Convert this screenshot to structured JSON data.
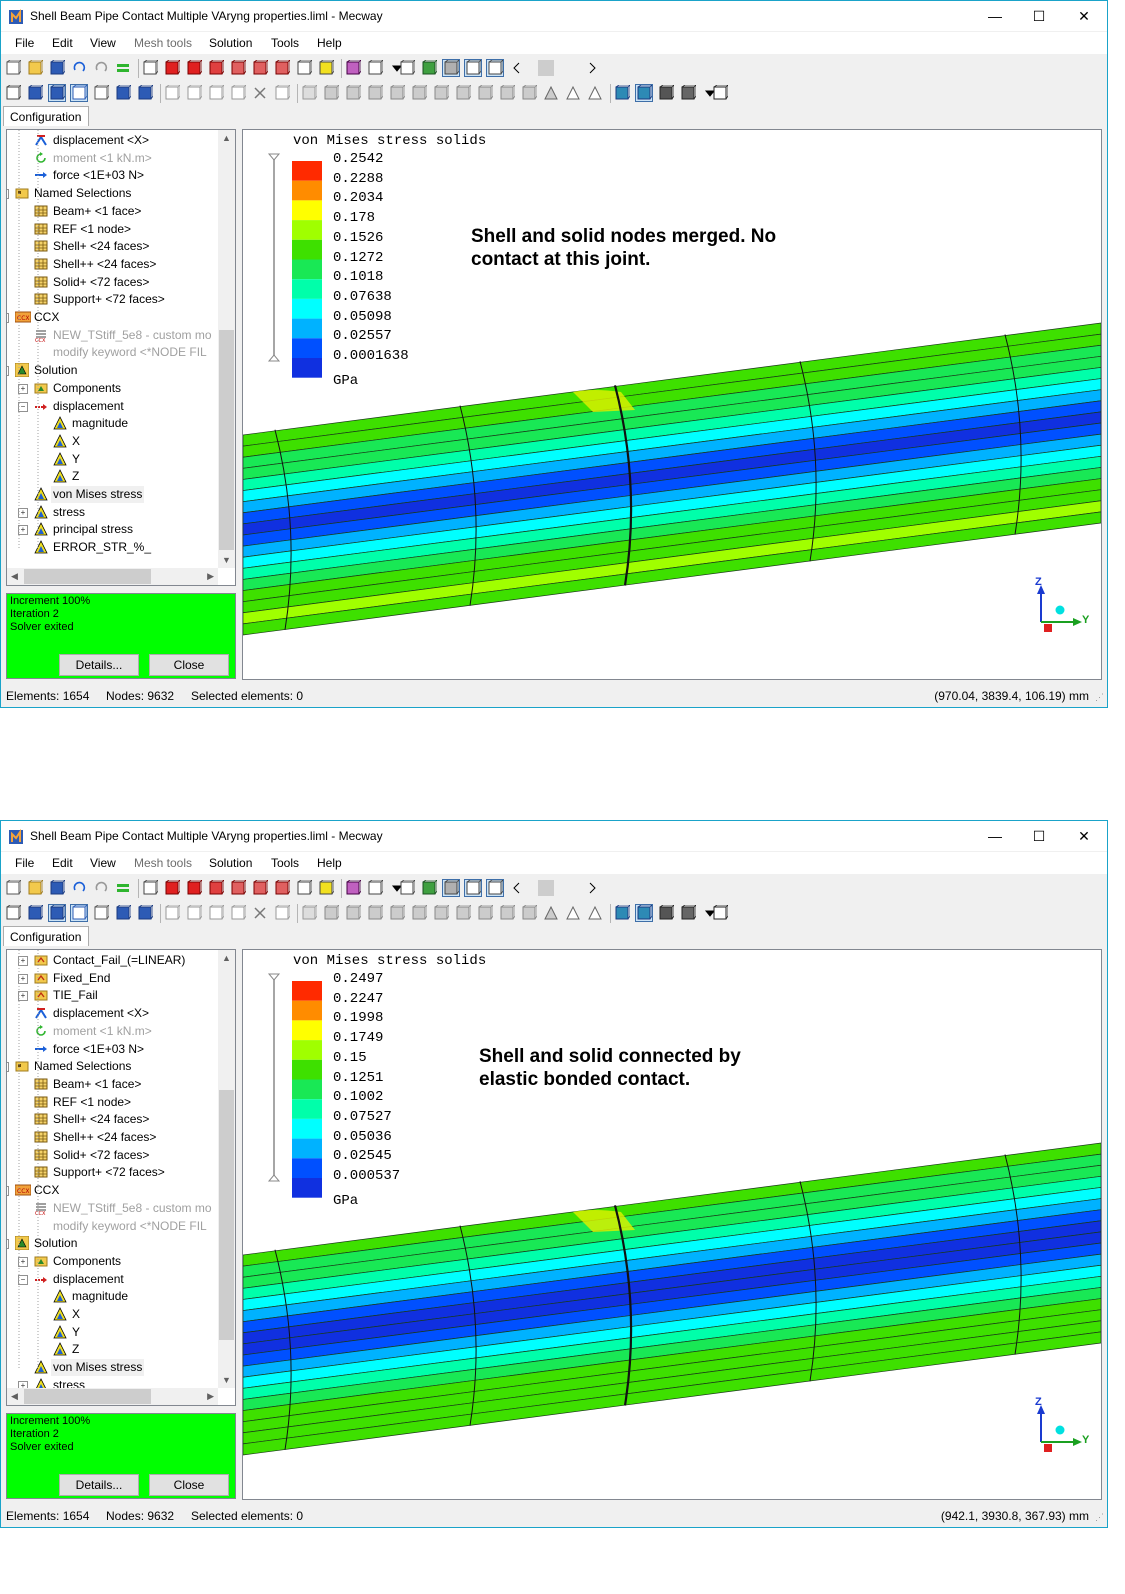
{
  "app": {
    "title": "Shell Beam Pipe Contact Multiple VAryng properties.liml - Mecway",
    "minimize": "—",
    "maximize": "☐",
    "close": "✕"
  },
  "menu": [
    "File",
    "Edit",
    "View",
    "Mesh tools",
    "Solution",
    "Tools",
    "Help"
  ],
  "config_tab": "Configuration",
  "solver": {
    "lines": [
      "Increment 100%",
      "Iteration 2",
      "Solver exited"
    ],
    "details": "Details...",
    "close": "Close"
  },
  "legend": {
    "title": "von Mises stress solids",
    "unit": "GPa",
    "colors": [
      "#ff2a00",
      "#ff8c00",
      "#ffff00",
      "#a0ff00",
      "#3ee000",
      "#19e855",
      "#00ffaa",
      "#00ffff",
      "#00b2ff",
      "#0050ff",
      "#1030e0"
    ]
  },
  "axes": {
    "z": "Z",
    "y": "Y"
  },
  "windows": [
    {
      "tree": [
        {
          "label": "displacement <X>",
          "icon": "displacement-icon",
          "indent": 2,
          "grey": false
        },
        {
          "label": "moment <1 kN.m>",
          "icon": "moment-icon",
          "indent": 2,
          "grey": true
        },
        {
          "label": "force <1E+03 N>",
          "icon": "force-icon",
          "indent": 2,
          "grey": false
        },
        {
          "label": "Named Selections",
          "icon": "folder-icon",
          "indent": 1,
          "exp": "-"
        },
        {
          "label": "Beam+ <1 face>",
          "icon": "selection-icon",
          "indent": 2
        },
        {
          "label": "REF <1 node>",
          "icon": "selection-icon",
          "indent": 2
        },
        {
          "label": "Shell+ <24 faces>",
          "icon": "selection-icon",
          "indent": 2
        },
        {
          "label": "Shell++ <24 faces>",
          "icon": "selection-icon",
          "indent": 2
        },
        {
          "label": "Solid+ <72 faces>",
          "icon": "selection-icon",
          "indent": 2
        },
        {
          "label": "Support+ <72 faces>",
          "icon": "selection-icon",
          "indent": 2
        },
        {
          "label": "CCX",
          "icon": "ccx-icon",
          "indent": 1,
          "exp": "-"
        },
        {
          "label": "NEW_TStiff_5e8 - custom mo",
          "icon": "custom-keyword-icon",
          "indent": 2,
          "grey": true
        },
        {
          "label": "modify keyword <*NODE FIL",
          "icon": "none",
          "indent": 2,
          "grey": true
        },
        {
          "label": "Solution",
          "icon": "solution-icon",
          "indent": 1,
          "exp": "-"
        },
        {
          "label": "Components",
          "icon": "components-icon",
          "indent": 2,
          "exp": "+"
        },
        {
          "label": "displacement",
          "icon": "displacement-result-icon",
          "indent": 2,
          "exp": "-"
        },
        {
          "label": "magnitude",
          "icon": "triangle-icon",
          "indent": 3
        },
        {
          "label": "X",
          "icon": "triangle-icon",
          "indent": 3
        },
        {
          "label": "Y",
          "icon": "triangle-icon",
          "indent": 3
        },
        {
          "label": "Z",
          "icon": "triangle-icon",
          "indent": 3
        },
        {
          "label": "von Mises stress",
          "icon": "triangle-icon",
          "indent": 2,
          "hl": true
        },
        {
          "label": "stress",
          "icon": "triangle-icon",
          "indent": 2,
          "exp": "+"
        },
        {
          "label": "principal stress",
          "icon": "triangle-icon",
          "indent": 2,
          "exp": "+"
        },
        {
          "label": "ERROR_STR_%_",
          "icon": "triangle-icon",
          "indent": 2
        }
      ],
      "legend_values": [
        "0.2542",
        "0.2288",
        "0.2034",
        "0.178",
        "0.1526",
        "0.1272",
        "0.1018",
        "0.07638",
        "0.05098",
        "0.02557",
        "0.0001638"
      ],
      "annotation": [
        "Shell and solid nodes merged. No",
        "contact at this joint."
      ],
      "status": {
        "elements": "Elements: 1654",
        "nodes": "Nodes: 9632",
        "selected": "Selected elements: 0",
        "coords": "(970.04, 3839.4, 106.19) mm"
      }
    },
    {
      "tree": [
        {
          "label": "Contact_Fail_(=LINEAR)",
          "icon": "contact-folder-icon",
          "indent": 2,
          "exp": "+"
        },
        {
          "label": "Fixed_End",
          "icon": "contact-folder-icon",
          "indent": 2,
          "exp": "+"
        },
        {
          "label": "TIE_Fail",
          "icon": "contact-folder-icon",
          "indent": 2,
          "exp": "+"
        },
        {
          "label": "displacement <X>",
          "icon": "displacement-icon",
          "indent": 2
        },
        {
          "label": "moment <1 kN.m>",
          "icon": "moment-icon",
          "indent": 2,
          "grey": true
        },
        {
          "label": "force <1E+03 N>",
          "icon": "force-icon",
          "indent": 2
        },
        {
          "label": "Named Selections",
          "icon": "folder-icon",
          "indent": 1,
          "exp": "-"
        },
        {
          "label": "Beam+ <1 face>",
          "icon": "selection-icon",
          "indent": 2
        },
        {
          "label": "REF <1 node>",
          "icon": "selection-icon",
          "indent": 2
        },
        {
          "label": "Shell+ <24 faces>",
          "icon": "selection-icon",
          "indent": 2
        },
        {
          "label": "Shell++ <24 faces>",
          "icon": "selection-icon",
          "indent": 2
        },
        {
          "label": "Solid+ <72 faces>",
          "icon": "selection-icon",
          "indent": 2
        },
        {
          "label": "Support+ <72 faces>",
          "icon": "selection-icon",
          "indent": 2
        },
        {
          "label": "CCX",
          "icon": "ccx-icon",
          "indent": 1,
          "exp": "-"
        },
        {
          "label": "NEW_TStiff_5e8 - custom mo",
          "icon": "custom-keyword-icon",
          "indent": 2,
          "grey": true
        },
        {
          "label": "modify keyword <*NODE FIL",
          "icon": "none",
          "indent": 2,
          "grey": true
        },
        {
          "label": "Solution",
          "icon": "solution-icon",
          "indent": 1,
          "exp": "-"
        },
        {
          "label": "Components",
          "icon": "components-icon",
          "indent": 2,
          "exp": "+"
        },
        {
          "label": "displacement",
          "icon": "displacement-result-icon",
          "indent": 2,
          "exp": "-"
        },
        {
          "label": "magnitude",
          "icon": "triangle-icon",
          "indent": 3
        },
        {
          "label": "X",
          "icon": "triangle-icon",
          "indent": 3
        },
        {
          "label": "Y",
          "icon": "triangle-icon",
          "indent": 3
        },
        {
          "label": "Z",
          "icon": "triangle-icon",
          "indent": 3
        },
        {
          "label": "von Mises stress",
          "icon": "triangle-icon",
          "indent": 2,
          "hl": true
        },
        {
          "label": "stress",
          "icon": "triangle-icon",
          "indent": 2,
          "exp": "+"
        }
      ],
      "legend_values": [
        "0.2497",
        "0.2247",
        "0.1998",
        "0.1749",
        "0.15",
        "0.1251",
        "0.1002",
        "0.07527",
        "0.05036",
        "0.02545",
        "0.000537"
      ],
      "annotation": [
        "Shell and solid connected by",
        "elastic bonded contact."
      ],
      "status": {
        "elements": "Elements: 1654",
        "nodes": "Nodes: 9632",
        "selected": "Selected elements: 0",
        "coords": "(942.1, 3930.8, 367.93) mm"
      }
    }
  ]
}
